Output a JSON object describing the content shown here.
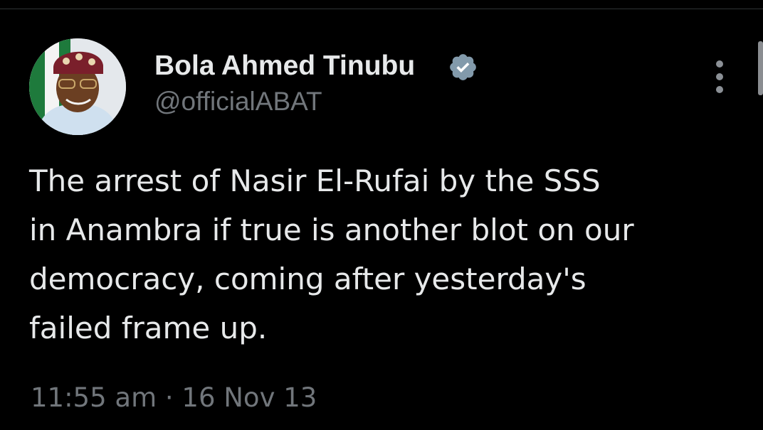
{
  "colors": {
    "background": "#000000",
    "primary_text": "#e7e9ea",
    "secondary_text": "#71767b",
    "verified_badge": "#829aab"
  },
  "tweet": {
    "author": {
      "display_name": "Bola Ahmed Tinubu",
      "handle": "@officialABAT",
      "verified": true,
      "verified_icon": "verified-badge-icon"
    },
    "text_lines": [
      "The arrest of Nasir El-Rufai by the SSS",
      "in Anambra if true is another blot on our",
      "democracy, coming after yesterday's",
      "failed frame up."
    ],
    "time": "11:55 am",
    "separator": "·",
    "date": "16 Nov 13",
    "more_icon": "more-options-icon"
  }
}
